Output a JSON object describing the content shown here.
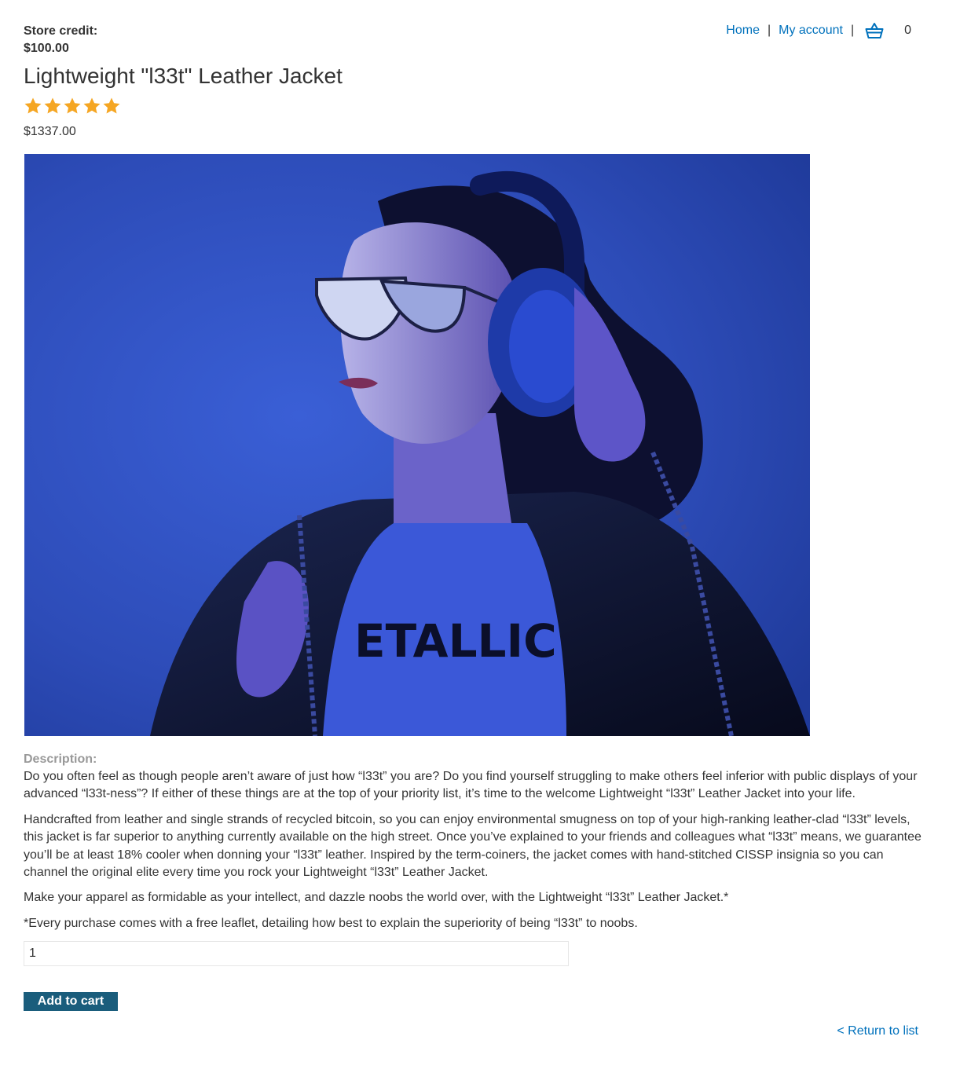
{
  "header": {
    "store_credit_label": "Store credit:",
    "store_credit_value": "$100.00",
    "nav": {
      "home": "Home",
      "separator": "|",
      "my_account": "My account",
      "cart_icon": "basket-icon",
      "cart_count": "0"
    }
  },
  "product": {
    "title": "Lightweight \"l33t\" Leather Jacket",
    "rating": 5,
    "rating_max": 5,
    "price": "$1337.00",
    "image_description_icon": "product-photo",
    "description_label": "Description:",
    "description_paragraphs": [
      "Do you often feel as though people aren’t aware of just how “l33t” you are? Do you find yourself struggling to make others feel inferior with public displays of your advanced “l33t-ness”? If either of these things are at the top of your priority list, it’s time to the welcome Lightweight “l33t” Leather Jacket into your life.",
      "Handcrafted from leather and single strands of recycled bitcoin, so you can enjoy environmental smugness on top of your high-ranking leather-clad “l33t” levels, this jacket is far superior to anything currently available on the high street. Once you’ve explained to your friends and colleagues what “l33t” means, we guarantee you’ll be at least 18% cooler when donning your “l33t” leather. Inspired by the term-coiners, the jacket comes with hand-stitched CISSP insignia so you can channel the original elite every time you rock your Lightweight “l33t” Leather Jacket.",
      "Make your apparel as formidable as your intellect, and dazzle noobs the world over, with the Lightweight “l33t” Leather Jacket.*",
      "*Every purchase comes with a free leaflet, detailing how best to explain the superiority of being “l33t” to noobs."
    ]
  },
  "cart_form": {
    "quantity_value": "1",
    "add_to_cart_label": "Add to cart"
  },
  "footer": {
    "return_link": "< Return to list"
  },
  "colors": {
    "link": "#0071bc",
    "button_bg": "#1a5d7c",
    "star": "#f5a623",
    "label_grey": "#999999"
  }
}
